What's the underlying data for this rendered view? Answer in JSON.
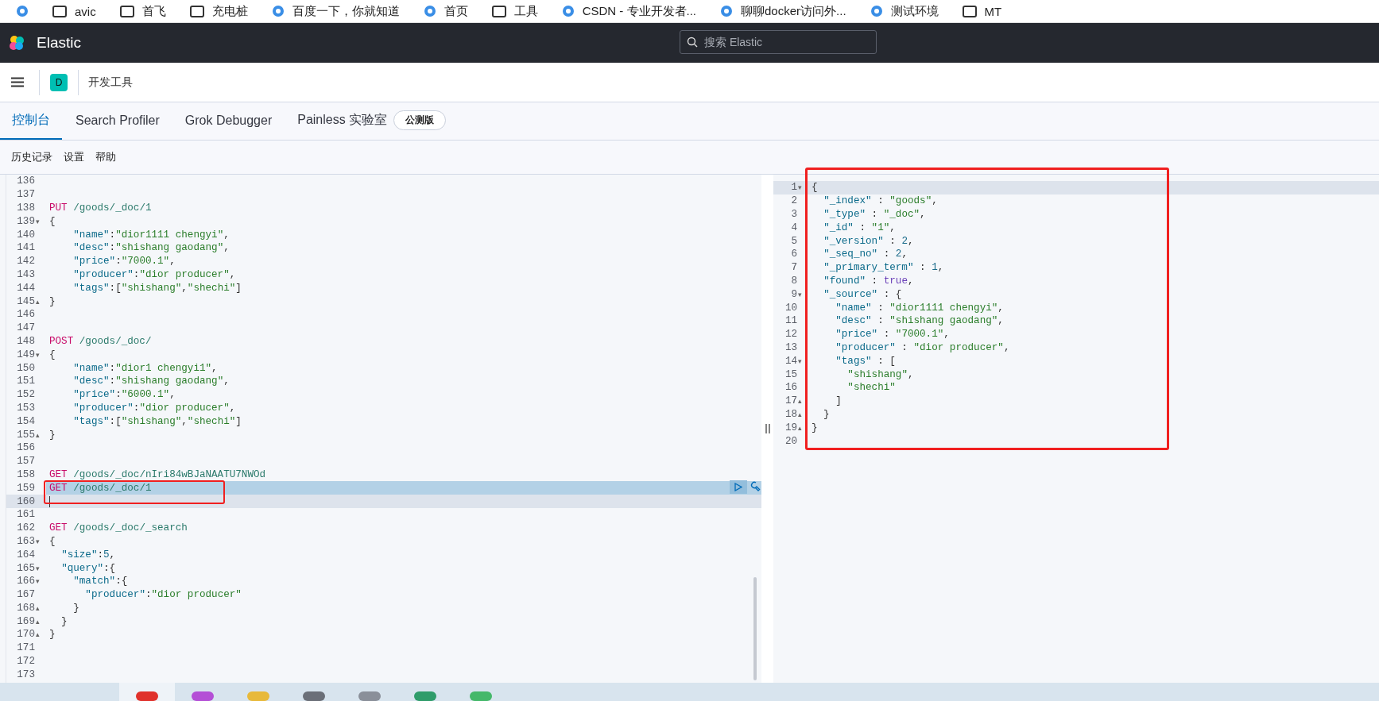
{
  "bookmarks": [
    {
      "kind": "site"
    },
    {
      "kind": "folder",
      "label": "avic"
    },
    {
      "kind": "folder",
      "label": "首飞"
    },
    {
      "kind": "folder",
      "label": "充电桩"
    },
    {
      "kind": "site",
      "label": "百度一下，你就知道"
    },
    {
      "kind": "site",
      "label": "首页"
    },
    {
      "kind": "folder",
      "label": "工具"
    },
    {
      "kind": "site",
      "label": "CSDN - 专业开发者..."
    },
    {
      "kind": "site",
      "label": "聊聊docker访问外..."
    },
    {
      "kind": "site",
      "label": "测试环境"
    },
    {
      "kind": "folder",
      "label": "MT"
    }
  ],
  "header": {
    "title": "Elastic",
    "search": {
      "placeholder": "搜索 Elastic"
    }
  },
  "breadcrumb": {
    "space": "D",
    "page": "开发工具"
  },
  "tabs": [
    {
      "label": "控制台",
      "selected": true
    },
    {
      "label": "Search Profiler",
      "selected": false
    },
    {
      "label": "Grok Debugger",
      "selected": false
    },
    {
      "label": "Painless 实验室",
      "selected": false,
      "badge": "公测版"
    }
  ],
  "menu": [
    "历史记录",
    "设置",
    "帮助"
  ],
  "editor": {
    "lines": [
      {
        "number": "136",
        "selected": false,
        "active": false
      },
      {
        "number": "137",
        "selected": false,
        "active": false
      },
      {
        "number": "138",
        "selected": false,
        "active": false,
        "method": "PUT",
        "path": "/goods/_doc/1"
      },
      {
        "number": "139",
        "selected": false,
        "active": false,
        "fold": "▾",
        "text": "{"
      },
      {
        "number": "140",
        "selected": false,
        "active": false,
        "text": "    \"name\":\"dior1111 chengyi\","
      },
      {
        "number": "141",
        "selected": false,
        "active": false,
        "text": "    \"desc\":\"shishang gaodang\","
      },
      {
        "number": "142",
        "selected": false,
        "active": false,
        "text": "    \"price\":\"7000.1\","
      },
      {
        "number": "143",
        "selected": false,
        "active": false,
        "text": "    \"producer\":\"dior producer\","
      },
      {
        "number": "144",
        "selected": false,
        "active": false,
        "text": "    \"tags\":[\"shishang\",\"shechi\"]"
      },
      {
        "number": "145",
        "selected": false,
        "active": false,
        "fold": "▴",
        "text": "}"
      },
      {
        "number": "146",
        "selected": false,
        "active": false
      },
      {
        "number": "147",
        "selected": false,
        "active": false
      },
      {
        "number": "148",
        "selected": false,
        "active": false,
        "method": "POST",
        "path": "/goods/_doc/"
      },
      {
        "number": "149",
        "selected": false,
        "active": false,
        "fold": "▾",
        "text": "{"
      },
      {
        "number": "150",
        "selected": false,
        "active": false,
        "text": "    \"name\":\"dior1 chengyi1\","
      },
      {
        "number": "151",
        "selected": false,
        "active": false,
        "text": "    \"desc\":\"shishang gaodang\","
      },
      {
        "number": "152",
        "selected": false,
        "active": false,
        "text": "    \"price\":\"6000.1\","
      },
      {
        "number": "153",
        "selected": false,
        "active": false,
        "text": "    \"producer\":\"dior producer\","
      },
      {
        "number": "154",
        "selected": false,
        "active": false,
        "text": "    \"tags\":[\"shishang\",\"shechi\"]"
      },
      {
        "number": "155",
        "selected": false,
        "active": false,
        "fold": "▴",
        "text": "}"
      },
      {
        "number": "156",
        "selected": false,
        "active": false
      },
      {
        "number": "157",
        "selected": false,
        "active": false
      },
      {
        "number": "158",
        "selected": false,
        "active": false,
        "method": "GET",
        "path": "/goods/_doc/nIri84wBJaNAATU7NWOd"
      },
      {
        "number": "159",
        "selected": true,
        "active": false,
        "method": "GET",
        "path": "/goods/_doc/1"
      },
      {
        "number": "160",
        "selected": false,
        "active": true
      },
      {
        "number": "161",
        "selected": false,
        "active": false
      },
      {
        "number": "162",
        "selected": false,
        "active": false,
        "method": "GET",
        "path": "/goods/_doc/_search"
      },
      {
        "number": "163",
        "selected": false,
        "active": false,
        "fold": "▾",
        "text": "{"
      },
      {
        "number": "164",
        "selected": false,
        "active": false,
        "text": "  \"size\":5,"
      },
      {
        "number": "165",
        "selected": false,
        "active": false,
        "fold": "▾",
        "text": "  \"query\":{"
      },
      {
        "number": "166",
        "selected": false,
        "active": false,
        "fold": "▾",
        "text": "    \"match\":{"
      },
      {
        "number": "167",
        "selected": false,
        "active": false,
        "text": "      \"producer\":\"dior producer\""
      },
      {
        "number": "168",
        "selected": false,
        "active": false,
        "fold": "▴",
        "text": "    }"
      },
      {
        "number": "169",
        "selected": false,
        "active": false,
        "fold": "▴",
        "text": "  }"
      },
      {
        "number": "170",
        "selected": false,
        "active": false,
        "fold": "▴",
        "text": "}"
      },
      {
        "number": "171",
        "selected": false,
        "active": false
      },
      {
        "number": "172",
        "selected": false,
        "active": false
      },
      {
        "number": "173",
        "selected": false,
        "active": false
      }
    ]
  },
  "output": {
    "lines": [
      {
        "number": "1",
        "active": true,
        "fold": "▾",
        "text": "{"
      },
      {
        "number": "2",
        "active": false,
        "text": "  \"_index\" : \"goods\","
      },
      {
        "number": "3",
        "active": false,
        "text": "  \"_type\" : \"_doc\","
      },
      {
        "number": "4",
        "active": false,
        "text": "  \"_id\" : \"1\","
      },
      {
        "number": "5",
        "active": false,
        "text": "  \"_version\" : 2,"
      },
      {
        "number": "6",
        "active": false,
        "text": "  \"_seq_no\" : 2,"
      },
      {
        "number": "7",
        "active": false,
        "text": "  \"_primary_term\" : 1,"
      },
      {
        "number": "8",
        "active": false,
        "text": "  \"found\" : true,"
      },
      {
        "number": "9",
        "active": false,
        "fold": "▾",
        "text": "  \"_source\" : {"
      },
      {
        "number": "10",
        "active": false,
        "text": "    \"name\" : \"dior1111 chengyi\","
      },
      {
        "number": "11",
        "active": false,
        "text": "    \"desc\" : \"shishang gaodang\","
      },
      {
        "number": "12",
        "active": false,
        "text": "    \"price\" : \"7000.1\","
      },
      {
        "number": "13",
        "active": false,
        "text": "    \"producer\" : \"dior producer\","
      },
      {
        "number": "14",
        "active": false,
        "fold": "▾",
        "text": "    \"tags\" : ["
      },
      {
        "number": "15",
        "active": false,
        "text": "      \"shishang\","
      },
      {
        "number": "16",
        "active": false,
        "text": "      \"shechi\""
      },
      {
        "number": "17",
        "active": false,
        "fold": "▴",
        "text": "    ]"
      },
      {
        "number": "18",
        "active": false,
        "fold": "▴",
        "text": "  }"
      },
      {
        "number": "19",
        "active": false,
        "fold": "▴",
        "text": "}"
      },
      {
        "number": "20",
        "active": false
      }
    ]
  },
  "taskbar": [
    {
      "color": "#e0312b",
      "selected": true
    },
    {
      "color": "#b44fd6",
      "selected": false
    },
    {
      "color": "#e8b93a",
      "selected": false
    },
    {
      "color": "#6b6f78",
      "selected": false
    },
    {
      "color": "#8a8f99",
      "selected": false
    },
    {
      "color": "#2f9c6a",
      "selected": false
    },
    {
      "color": "#45b86a",
      "selected": false
    }
  ]
}
